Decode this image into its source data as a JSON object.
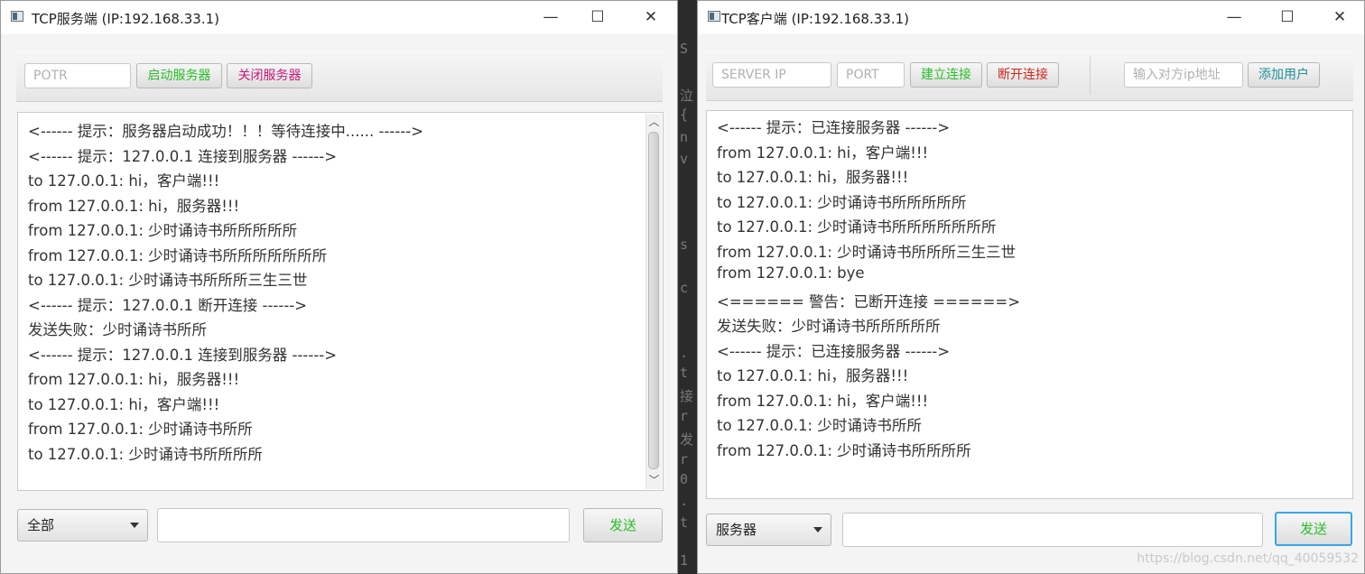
{
  "server": {
    "title": "TCP服务端 (IP:192.168.33.1)",
    "port_placeholder": "POTR",
    "start_label": "启动服务器",
    "stop_label": "关闭服务器",
    "log": [
      "<------ 提示：服务器启动成功！！！等待连接中...... ------>",
      "<------ 提示：127.0.0.1 连接到服务器 ------>",
      "to 127.0.0.1: hi，客户端!!!",
      "from 127.0.0.1: hi，服务器!!!",
      "from 127.0.0.1: 少时诵诗书所所所所所",
      "from 127.0.0.1: 少时诵诗书所所所所所所所",
      "to 127.0.0.1: 少时诵诗书所所所三生三世",
      "<------ 提示：127.0.0.1 断开连接 ------>",
      "发送失败：少时诵诗书所所",
      "<------ 提示：127.0.0.1 连接到服务器 ------>",
      "from 127.0.0.1: hi，服务器!!!",
      "to 127.0.0.1: hi，客户端!!!",
      "from 127.0.0.1: 少时诵诗书所所",
      "to 127.0.0.1: 少时诵诗书所所所所"
    ],
    "target_selected": "全部",
    "send_label": "发送"
  },
  "client": {
    "title": "TCP客户端 (IP:192.168.33.1)",
    "server_ip_placeholder": "SERVER  IP",
    "port_placeholder": "PORT",
    "connect_label": "建立连接",
    "disconnect_label": "断开连接",
    "peer_ip_placeholder": "输入对方ip地址",
    "add_user_label": "添加用户",
    "log": [
      "<------ 提示：已连接服务器 ------>",
      "from 127.0.0.1: hi，客户端!!!",
      "to 127.0.0.1: hi，服务器!!!",
      "to 127.0.0.1: 少时诵诗书所所所所所",
      "to 127.0.0.1: 少时诵诗书所所所所所所所",
      "from 127.0.0.1: 少时诵诗书所所所三生三世",
      "from 127.0.0.1: bye",
      "<====== 警告：已断开连接 ======>",
      "发送失败：少时诵诗书所所所所所",
      "<------ 提示：已连接服务器 ------>",
      "to 127.0.0.1: hi，服务器!!!",
      "from 127.0.0.1: hi，客户端!!!",
      "to 127.0.0.1: 少时诵诗书所所",
      "from 127.0.0.1: 少时诵诗书所所所所"
    ],
    "target_selected": "服务器",
    "send_label": "发送"
  },
  "window_controls": {
    "minimize": "—",
    "maximize": "☐",
    "close": "✕"
  },
  "watermark": "https://blog.csdn.net/qq_40059532",
  "colors": {
    "green": "#2bbd2b",
    "magenta": "#c8177a",
    "red": "#d0281e",
    "teal": "#1f8f9c",
    "focus": "#39a6e4"
  }
}
